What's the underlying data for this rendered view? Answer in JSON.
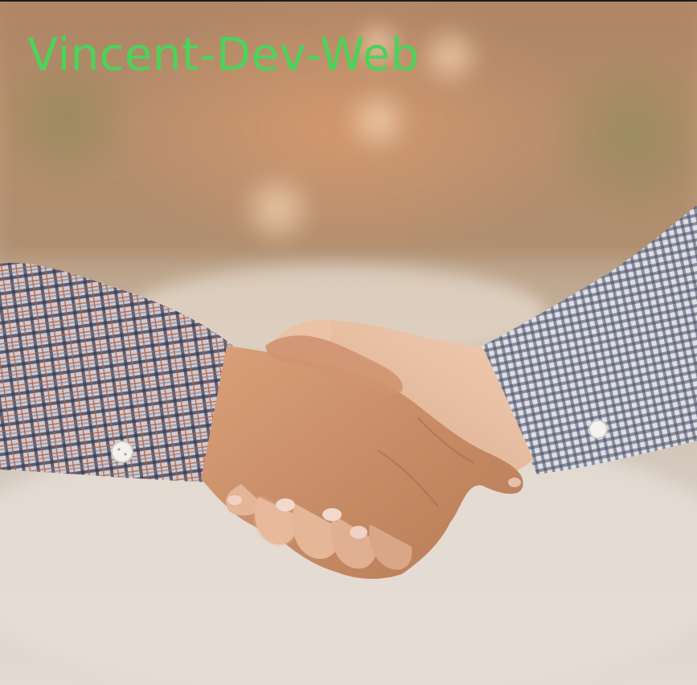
{
  "brand": {
    "title": "Vincent-Dev-Web",
    "color": "#4bd35a"
  },
  "photo": {
    "subject": "handshake-photo"
  }
}
